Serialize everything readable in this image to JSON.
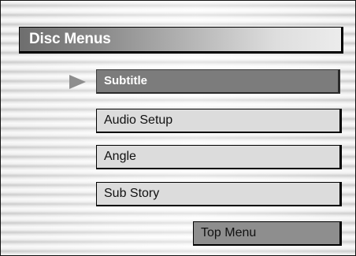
{
  "header": {
    "title": "Disc Menus"
  },
  "menu": {
    "items": [
      {
        "label": "Subtitle",
        "selected": true
      },
      {
        "label": "Audio Setup",
        "selected": false
      },
      {
        "label": "Angle",
        "selected": false
      },
      {
        "label": "Sub Story",
        "selected": false
      }
    ],
    "top_menu_label": "Top Menu",
    "selection_indicator_icon": "play-arrow-icon"
  },
  "colors": {
    "selected_bg": "#7c7c7c",
    "button_bg": "#dcdcdc",
    "top_menu_bg": "#8e8e8e",
    "title_text": "#ffffff"
  }
}
